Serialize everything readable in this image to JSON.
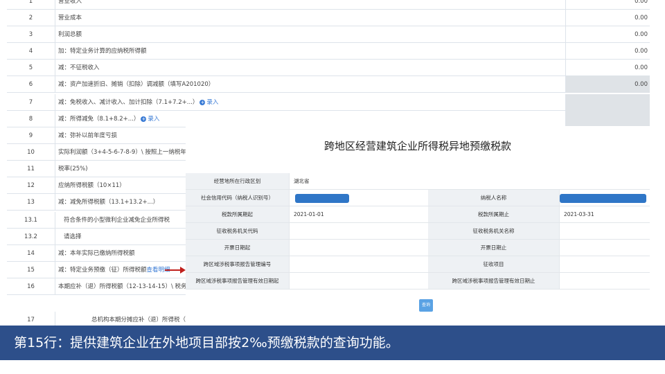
{
  "background_table": {
    "rows": [
      {
        "num": "1",
        "label": "营业收入",
        "value": "0.00"
      },
      {
        "num": "2",
        "label": "营业成本",
        "value": "0.00"
      },
      {
        "num": "3",
        "label": "利润总额",
        "value": "0.00"
      },
      {
        "num": "4",
        "label": "加：特定业务计算的应纳税所得额",
        "value": "0.00"
      },
      {
        "num": "5",
        "label": "减：不征税收入",
        "value": "0.00"
      },
      {
        "num": "6",
        "label": "减：资产加速折旧、摊销（扣除）调减额（填写A201020）",
        "value": "0.00"
      },
      {
        "num": "7",
        "label": "减：免税收入、减计收入、加计扣除（7.1+7.2+...）",
        "link": "录入",
        "value": ""
      },
      {
        "num": "8",
        "label": "减：所得减免（8.1+8.2+...）",
        "link": "录入",
        "value": ""
      },
      {
        "num": "9",
        "label": "减：弥补以前年度亏损",
        "value": ""
      },
      {
        "num": "10",
        "label": "实际利润额（3+4-5-6-7-8-9）\\ 按照上一纳税年度",
        "value": ""
      },
      {
        "num": "11",
        "label": "税率(25%)",
        "value": ""
      },
      {
        "num": "12",
        "label": "应纳所得税额（10×11）",
        "value": ""
      },
      {
        "num": "13",
        "label": "减：减免所得税额（13.1+13.2+...）",
        "value": ""
      },
      {
        "num": "13.1",
        "label": "符合条件的小型微利企业减免企业所得税",
        "value": ""
      },
      {
        "num": "13.2",
        "label": "请选择",
        "value": ""
      },
      {
        "num": "14",
        "label": "减：本年实际已缴纳所得税额",
        "value": ""
      },
      {
        "num": "15",
        "label": "减：特定业务预缴（征）所得税额",
        "link": "查看明细",
        "value": ""
      },
      {
        "num": "16",
        "label": "本期应补（退）所得税额（12-13-14-15）\\ 税务机",
        "value": ""
      },
      {
        "num": "17",
        "label": "总机构本期分摊应补（退）所得税（",
        "value": ""
      }
    ]
  },
  "popup": {
    "title": "跨地区经营建筑企业所得税异地预缴税款",
    "labels": {
      "region": "经营地所在行政区划",
      "credit_code": "社会信用代码（纳税人识别号）",
      "taxpayer_name": "纳税人名称",
      "period_start": "税款所属期起",
      "period_end": "税款所属期止",
      "tax_office_code": "征收税务机关代码",
      "tax_office_name": "征收税务机关名称",
      "issue_date": "开票日期起",
      "issue_date_end": "开票日期止",
      "cert_no": "跨区域涉税事项报告管理编号",
      "levy_item": "征收项目",
      "valid_start": "跨区域涉税事项报告管理有效日期起",
      "valid_end": "跨区域涉税事项报告管理有效日期止"
    },
    "values": {
      "region": "湖北省",
      "period_start": "2021-01-01",
      "period_end": "2021-03-31"
    },
    "query_button": "查询"
  },
  "banner_text": "第15行：提供建筑企业在外地项目部按2‰预缴税款的查询功能。",
  "colors": {
    "banner": "#2d4f8a",
    "link": "#3a7bd5",
    "arrow": "#c0201c",
    "redaction": "#2f76c7"
  }
}
